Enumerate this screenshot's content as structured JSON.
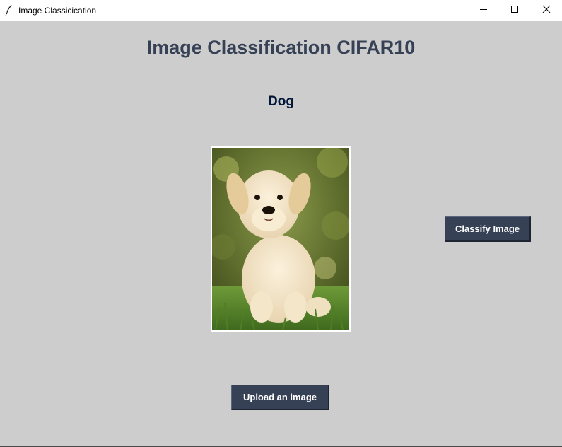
{
  "window": {
    "title": "Image Classicication",
    "icons": {
      "app": "feather-icon",
      "minimize": "minimize-icon",
      "maximize": "maximize-icon",
      "close": "close-icon"
    }
  },
  "main": {
    "heading": "Image Classification CIFAR10",
    "result_label": "Dog",
    "image_subject": "labrador-puppy-photo",
    "classify_button": "Classify Image",
    "upload_button": "Upload an image"
  },
  "colors": {
    "background": "#cdcdcd",
    "heading": "#364156",
    "result": "#011638",
    "button_bg": "#364156",
    "button_text": "#ffffff"
  }
}
